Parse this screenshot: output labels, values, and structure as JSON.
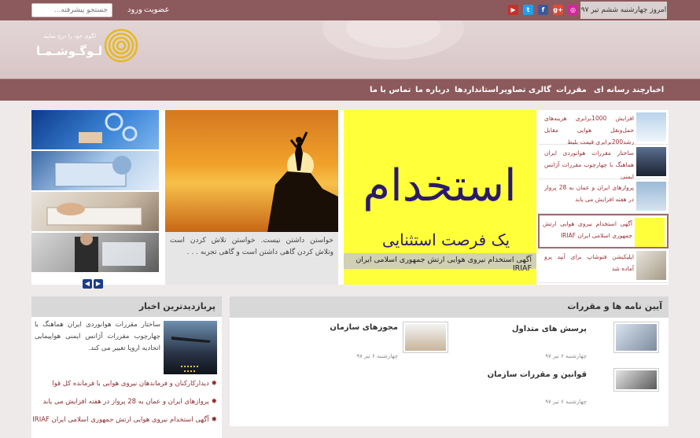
{
  "topbar": {
    "search_placeholder": "جستجو پیشرفته...",
    "login": "ورود",
    "register": "عضویت",
    "date": "امروز چهارشنبه ششم تیر ۹۷",
    "social_icons": [
      "youtube-icon",
      "twitter-icon",
      "facebook-icon",
      "google-plus-icon",
      "instagram-icon"
    ]
  },
  "header": {
    "logo_name": "لـوگـوشـمـا",
    "logo_tagline": "لگوی خود را درج نمایید"
  },
  "nav": [
    "اخبار",
    "چند رسانه ای",
    "مقررات",
    "گالری تصاویر",
    "استانداردها",
    "درباره ما",
    "تماس با ما"
  ],
  "slider": {
    "mid_caption": "خواستن داشتن نیست. خواستن تلاش کردن است وتلاش کردن گاهی داشتن است و گاهی تجربه . . .",
    "main_caption": "آگهی استخدام نیروی هوایی ارتش جمهوری اسلامی ایران IRIAF",
    "main_image_text": "استخدام",
    "main_image_subtext": "یک فرصت استثنایی",
    "list": [
      "افزایش 1000برابری هزینه‌های حمل‌ونقل هوایی مقابل رشد200برابری قیمت بلیط",
      "ساختار مقررات هوانوردی ایران هماهنگ با چهارچوب مقررات آژانس ایمنی",
      "پروازهای ایران و عمان به 28 پرواز در هفته افزایش می یابد",
      "آگهی استخدام نیروی هوایی ارتش جمهوری اسلامی ایران IRIAF",
      "اپلیکیشن فتوشاپ برای آیپد پرو آماده شد"
    ]
  },
  "news": {
    "title": "پربازدیدترین اخبار",
    "feature": "ساختار مقررات هوانوردی ایران هماهنگ با چهارچوب مقررات آژانس ایمنی هواپیمایی اتحادیه اروپا تغییر می کند.",
    "links": [
      "دیدارکارکنان و فرماندهان نیروی هوایی با فرمانده کل قوا",
      "پروازهای ایران و عمان به 28 پرواز در هفته افزایش می یابد",
      "آگهی استخدام نیروی هوایی ارتش جمهوری اسلامی ایران IRIAF"
    ]
  },
  "rules": {
    "title": "آیین نامه ها و مقررات",
    "items": [
      {
        "title": "پرسش های متداول",
        "date": "چهارشنبه ۶ تیر ۹۷"
      },
      {
        "title": "مجوزهای سازمان",
        "date": "چهارشنبه ۶ تیر ۹۷"
      },
      {
        "title": "قوانین و مقررات سازمان",
        "date": "چهارشنبه ۶ تیر ۹۷"
      }
    ]
  }
}
